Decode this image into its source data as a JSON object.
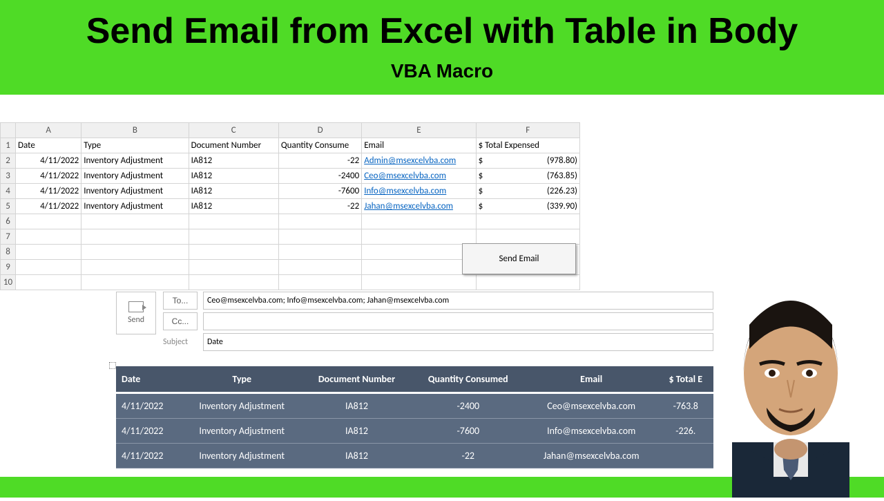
{
  "banner": {
    "title": "Send Email from Excel with Table in Body",
    "subtitle": "VBA Macro"
  },
  "excel": {
    "columns": [
      "A",
      "B",
      "C",
      "D",
      "E",
      "F"
    ],
    "headers": {
      "date": "Date",
      "type": "Type",
      "docnum": "Document Number",
      "qty": "Quantity Consume",
      "email": "Email",
      "total": "$ Total Expensed"
    },
    "rows": [
      {
        "date": "4/11/2022",
        "type": "Inventory Adjustment",
        "doc": "IA812",
        "qty": "-22",
        "email": "Admin@msexcelvba.com",
        "curr": "$",
        "amt": "(978.80)"
      },
      {
        "date": "4/11/2022",
        "type": "Inventory Adjustment",
        "doc": "IA812",
        "qty": "-2400",
        "email": "Ceo@msexcelvba.com",
        "curr": "$",
        "amt": "(763.85)"
      },
      {
        "date": "4/11/2022",
        "type": "Inventory Adjustment",
        "doc": "IA812",
        "qty": "-7600",
        "email": "Info@msexcelvba.com",
        "curr": "$",
        "amt": "(226.23)"
      },
      {
        "date": "4/11/2022",
        "type": "Inventory Adjustment",
        "doc": "IA812",
        "qty": "-22",
        "email": "Jahan@msexcelvba.com",
        "curr": "$",
        "amt": "(339.90)"
      }
    ],
    "button": "Send Email"
  },
  "outlook": {
    "send_label": "Send",
    "to_label": "To...",
    "cc_label": "Cc...",
    "subject_label": "Subject",
    "to_value": "Ceo@msexcelvba.com; Info@msexcelvba.com; Jahan@msexcelvba.com",
    "cc_value": "",
    "subject_value": "Date",
    "body_headers": {
      "date": "Date",
      "type": "Type",
      "doc": "Document Number",
      "qty": "Quantity Consumed",
      "email": "Email",
      "total": "$ Total E"
    },
    "body_rows": [
      {
        "date": "4/11/2022",
        "type": "Inventory Adjustment",
        "doc": "IA812",
        "qty": "-2400",
        "email": "Ceo@msexcelvba.com",
        "total": "-763.8"
      },
      {
        "date": "4/11/2022",
        "type": "Inventory Adjustment",
        "doc": "IA812",
        "qty": "-7600",
        "email": "Info@msexcelvba.com",
        "total": "-226."
      },
      {
        "date": "4/11/2022",
        "type": "Inventory Adjustment",
        "doc": "IA812",
        "qty": "-22",
        "email": "Jahan@msexcelvba.com",
        "total": ""
      }
    ]
  }
}
